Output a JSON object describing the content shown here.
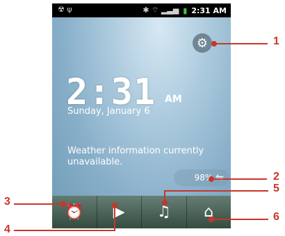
{
  "status_bar": {
    "left_icons": "☢ ψ",
    "right_icons": "✱ ⌔ ▂▃▅",
    "battery_icon": "▮",
    "time": "2:31 AM"
  },
  "clock": {
    "time": "2:31",
    "ampm": "AM",
    "date": "Sunday, January 6"
  },
  "weather": {
    "text": "Weather information currently unavailable."
  },
  "settings_widget": {
    "icon": "settings-gear-icon"
  },
  "battery_widget": {
    "value": "98%",
    "icon": "⇋"
  },
  "dock": {
    "items": [
      {
        "name": "alarm",
        "icon": "⏰"
      },
      {
        "name": "gallery",
        "icon": "▶"
      },
      {
        "name": "music",
        "icon": "♫"
      },
      {
        "name": "home",
        "icon": "⌂"
      }
    ]
  },
  "callouts": {
    "numbers": [
      "1",
      "2",
      "3",
      "4",
      "5",
      "6"
    ],
    "color": "#c8362a"
  }
}
